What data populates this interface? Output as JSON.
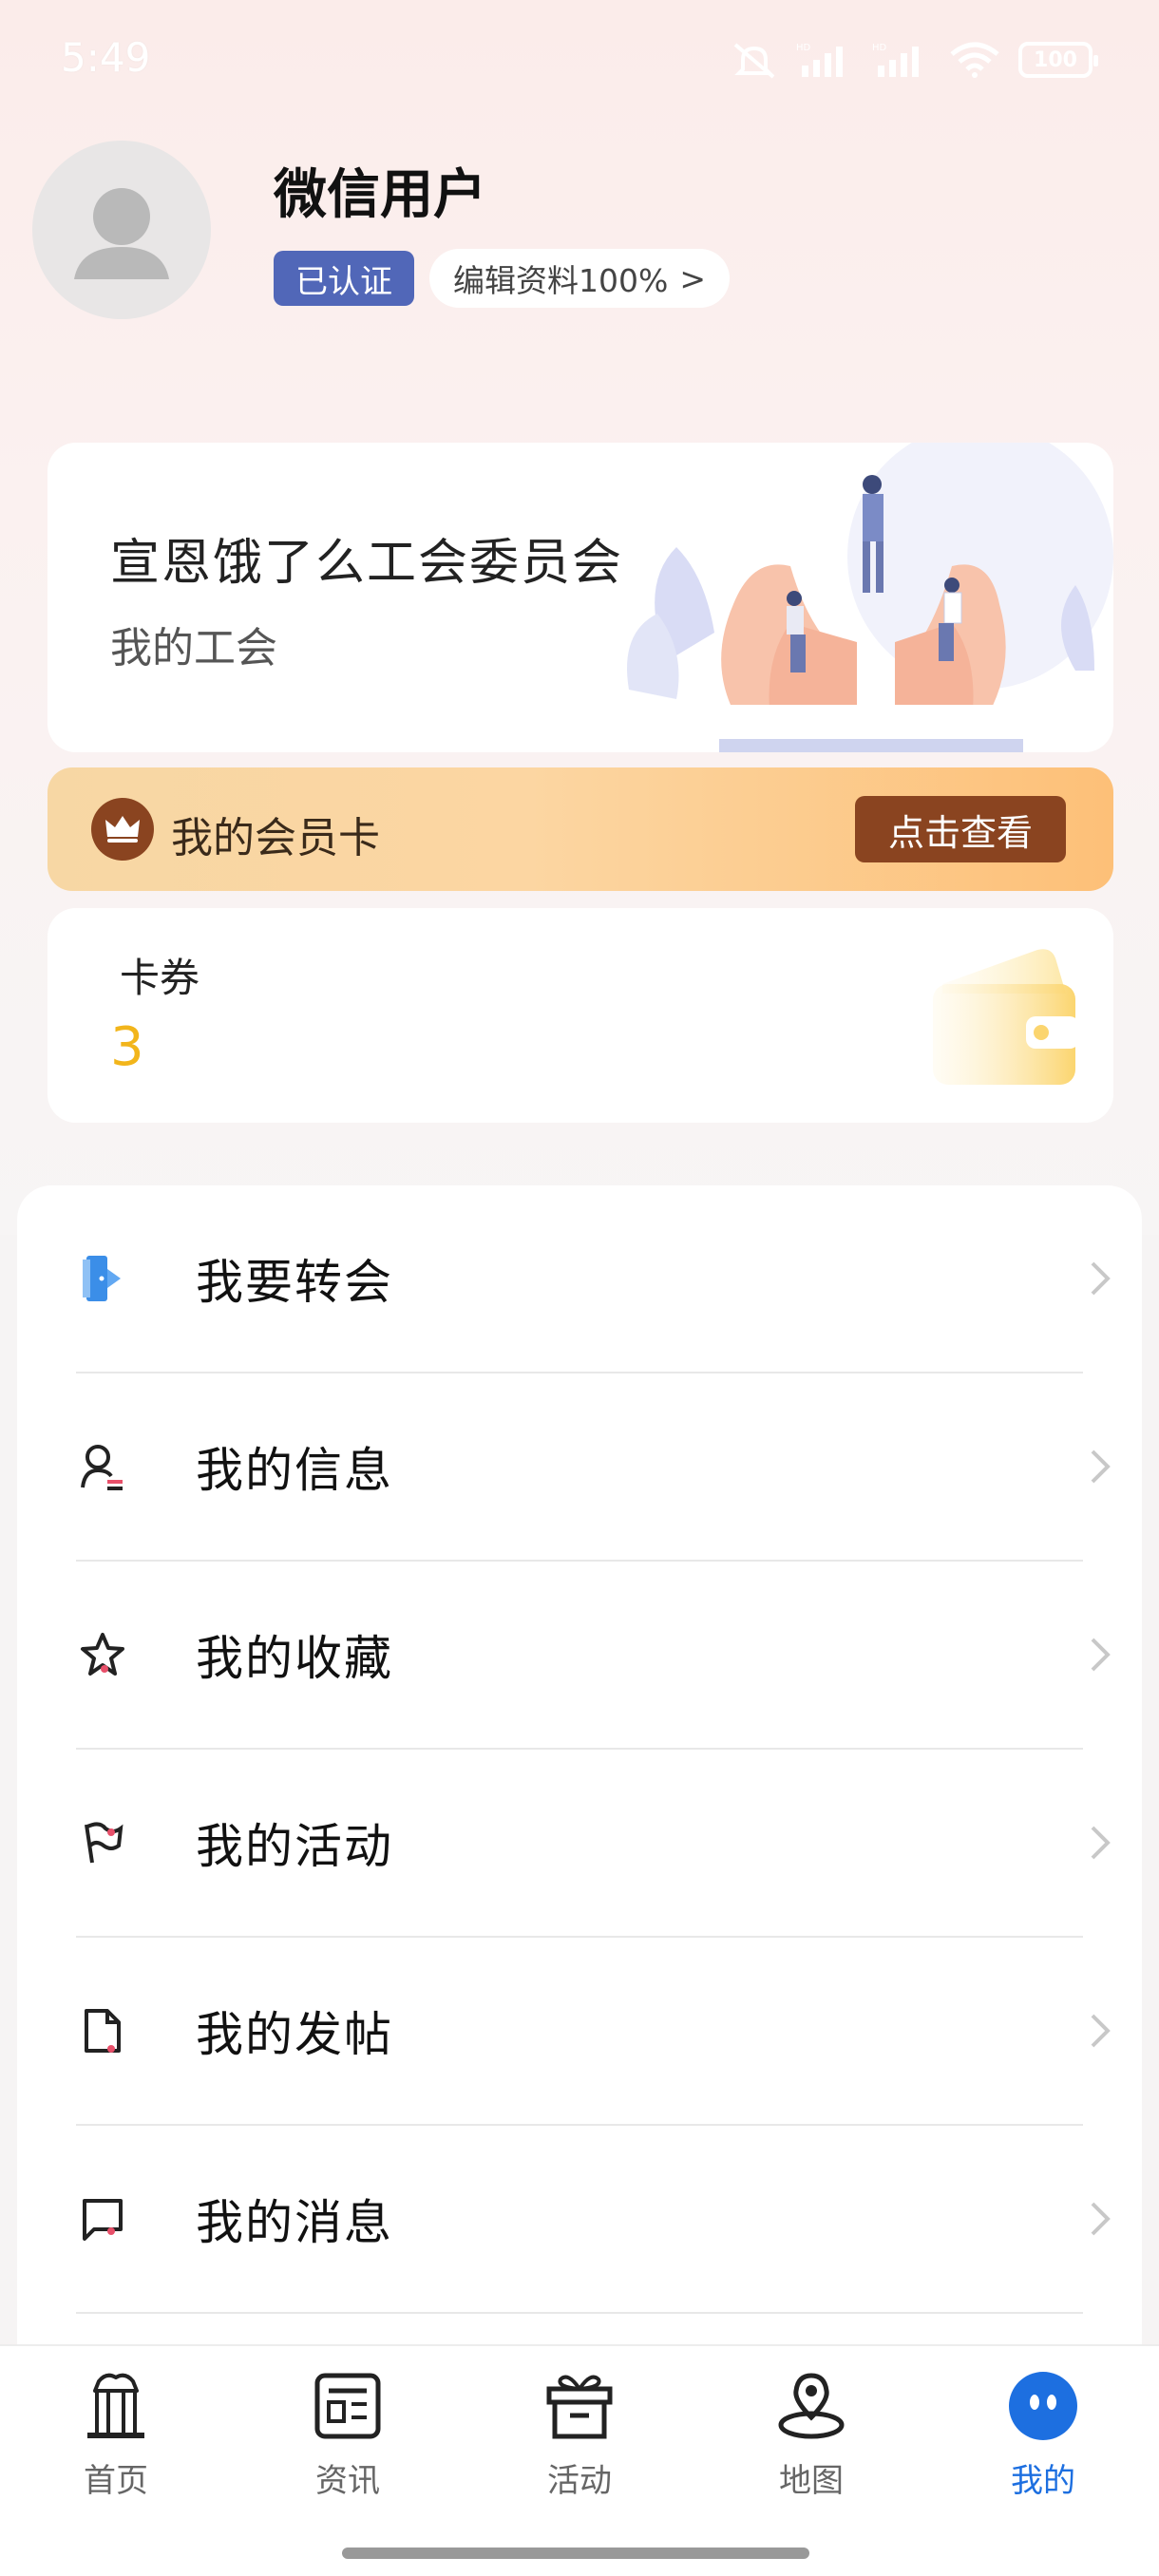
{
  "status_bar": {
    "time": "5:49",
    "battery": "100"
  },
  "profile": {
    "name": "微信用户",
    "verified_label": "已认证",
    "edit_label": "编辑资料100%",
    "edit_arrow": ">"
  },
  "union": {
    "name": "宣恩饿了么工会委员会",
    "subtitle": "我的工会"
  },
  "member": {
    "label": "我的会员卡",
    "button": "点击查看"
  },
  "coupon": {
    "label": "卡券",
    "count": "3"
  },
  "menu": {
    "items": [
      {
        "label": "我要转会",
        "icon": "transfer-door-icon"
      },
      {
        "label": "我的信息",
        "icon": "person-info-icon"
      },
      {
        "label": "我的收藏",
        "icon": "star-icon"
      },
      {
        "label": "我的活动",
        "icon": "flag-icon"
      },
      {
        "label": "我的发帖",
        "icon": "document-icon"
      },
      {
        "label": "我的消息",
        "icon": "message-icon"
      }
    ]
  },
  "nav": {
    "items": [
      {
        "label": "首页",
        "icon": "gate-icon"
      },
      {
        "label": "资讯",
        "icon": "news-icon"
      },
      {
        "label": "活动",
        "icon": "gift-icon"
      },
      {
        "label": "地图",
        "icon": "map-pin-icon"
      },
      {
        "label": "我的",
        "icon": "me-face-icon"
      }
    ],
    "active_index": 4
  },
  "colors": {
    "accent_blue": "#1d6fe0",
    "badge_blue": "#5167b8",
    "member_brown": "#8a4420",
    "coupon_yellow": "#f2b51b"
  }
}
